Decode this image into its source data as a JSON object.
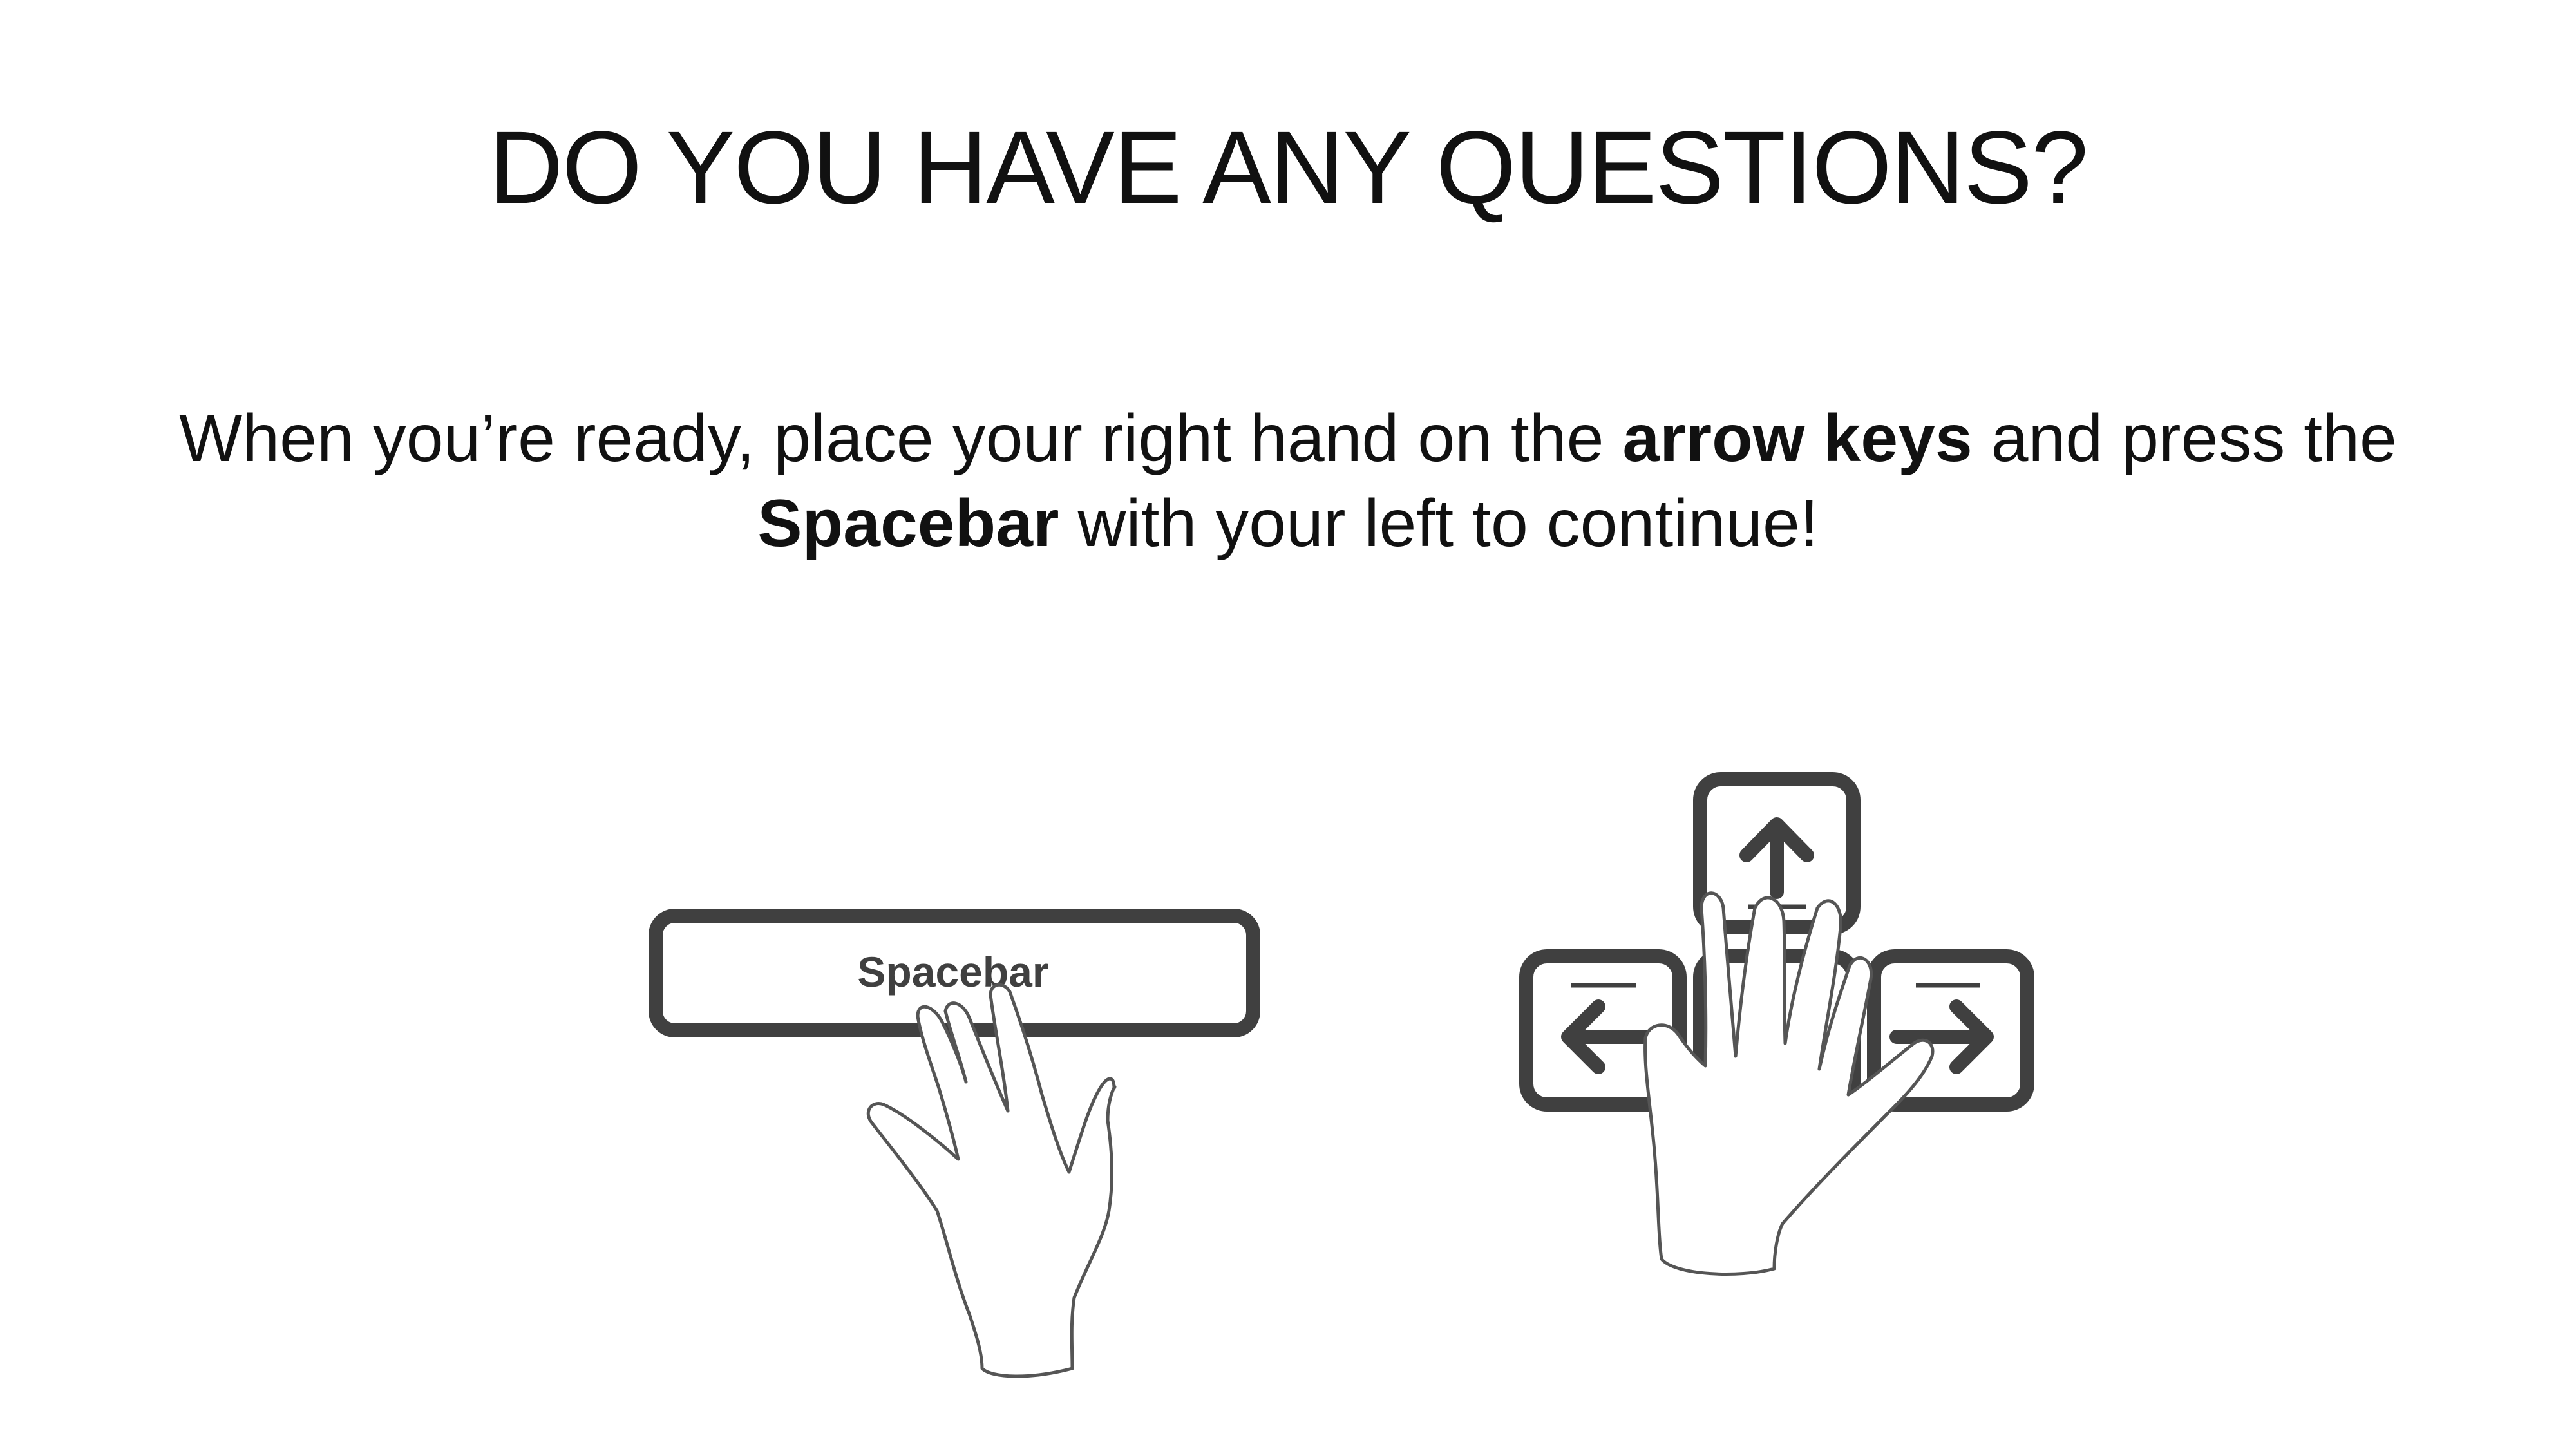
{
  "slide": {
    "title": "DO YOU HAVE ANY QUESTIONS?",
    "instructions": {
      "part1": "When you’re ready, place your right hand on the ",
      "bold1": "arrow keys",
      "part2": " and press the ",
      "bold2": "Spacebar",
      "part3": " with your left to continue!"
    }
  },
  "illustration": {
    "spacebar_label": "Spacebar",
    "icons": [
      "spacebar-key",
      "left-hand",
      "arrow-up-key",
      "arrow-left-key",
      "arrow-down-key",
      "arrow-right-key",
      "right-hand"
    ]
  }
}
